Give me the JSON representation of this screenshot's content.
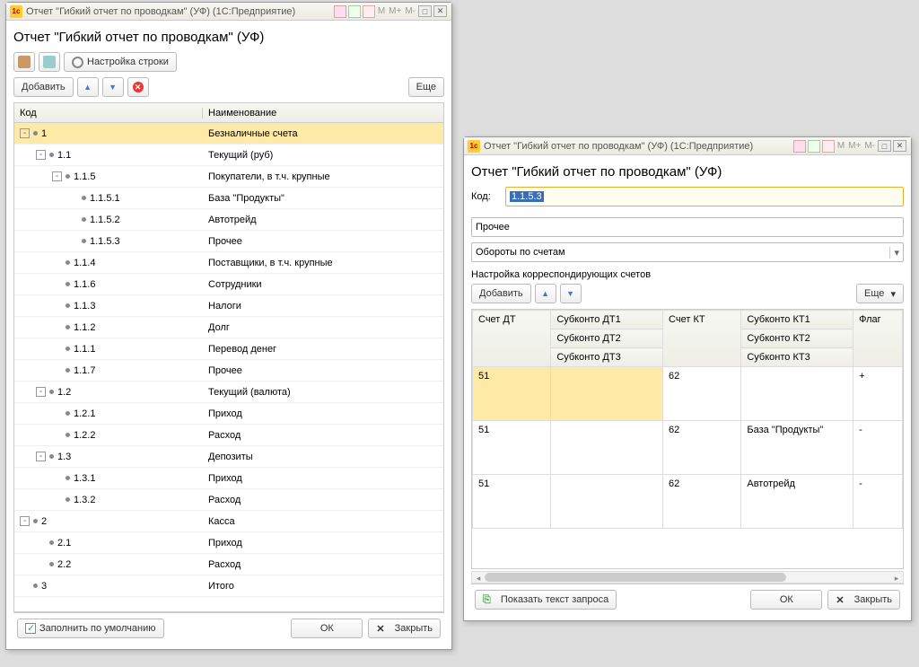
{
  "app_suffix": "(1С:Предприятие)",
  "memory_buttons": [
    "M",
    "M+",
    "M-"
  ],
  "w1": {
    "title_prefix": "Отчет \"Гибкий отчет по проводкам\" (УФ)  ",
    "heading": "Отчет \"Гибкий отчет по проводкам\" (УФ)",
    "settings_label": "Настройка строки",
    "add_label": "Добавить",
    "more_label": "Еще",
    "col_code": "Код",
    "col_name": "Наименование",
    "rows": [
      {
        "lvl": 0,
        "exp": "-",
        "code": "1",
        "name": "Безналичные счета",
        "sel": true
      },
      {
        "lvl": 1,
        "exp": "-",
        "code": "1.1",
        "name": "Текущий (руб)"
      },
      {
        "lvl": 2,
        "exp": "-",
        "code": "1.1.5",
        "name": "Покупатели, в т.ч. крупные"
      },
      {
        "lvl": 3,
        "exp": "",
        "code": "1.1.5.1",
        "name": "База \"Продукты\""
      },
      {
        "lvl": 3,
        "exp": "",
        "code": "1.1.5.2",
        "name": "Автотрейд"
      },
      {
        "lvl": 3,
        "exp": "",
        "code": "1.1.5.3",
        "name": "Прочее"
      },
      {
        "lvl": 2,
        "exp": "",
        "code": "1.1.4",
        "name": "Поставщики, в т.ч. крупные"
      },
      {
        "lvl": 2,
        "exp": "",
        "code": "1.1.6",
        "name": "Сотрудники"
      },
      {
        "lvl": 2,
        "exp": "",
        "code": "1.1.3",
        "name": "Налоги"
      },
      {
        "lvl": 2,
        "exp": "",
        "code": "1.1.2",
        "name": "Долг"
      },
      {
        "lvl": 2,
        "exp": "",
        "code": "1.1.1",
        "name": "Перевод денег"
      },
      {
        "lvl": 2,
        "exp": "",
        "code": "1.1.7",
        "name": "Прочее"
      },
      {
        "lvl": 1,
        "exp": "-",
        "code": "1.2",
        "name": "Текущий (валюта)"
      },
      {
        "lvl": 2,
        "exp": "",
        "code": "1.2.1",
        "name": "Приход"
      },
      {
        "lvl": 2,
        "exp": "",
        "code": "1.2.2",
        "name": "Расход"
      },
      {
        "lvl": 1,
        "exp": "-",
        "code": "1.3",
        "name": "Депозиты"
      },
      {
        "lvl": 2,
        "exp": "",
        "code": "1.3.1",
        "name": "Приход"
      },
      {
        "lvl": 2,
        "exp": "",
        "code": "1.3.2",
        "name": "Расход"
      },
      {
        "lvl": 0,
        "exp": "-",
        "code": "2",
        "name": "Касса"
      },
      {
        "lvl": 1,
        "exp": "",
        "code": "2.1",
        "name": "Приход"
      },
      {
        "lvl": 1,
        "exp": "",
        "code": "2.2",
        "name": "Расход"
      },
      {
        "lvl": 0,
        "exp": "",
        "code": "3",
        "name": "Итого"
      }
    ],
    "fill_default": "Заполнить по умолчанию",
    "ok": "ОК",
    "close": "Закрыть"
  },
  "w2": {
    "title_prefix": "Отчет \"Гибкий отчет по проводкам\" (УФ)  ",
    "heading": "Отчет \"Гибкий отчет по проводкам\" (УФ)",
    "code_label": "Код:",
    "code_value": "1.1.5.3",
    "name_value": "Прочее",
    "combo_value": "Обороты по счетам",
    "section_label": "Настройка корреспондирующих счетов",
    "add_label": "Добавить",
    "more_label": "Еще",
    "hdr": {
      "dt": "Счет ДТ",
      "sdt1": "Субконто ДТ1",
      "sdt2": "Субконто ДТ2",
      "sdt3": "Субконто ДТ3",
      "kt": "Счет КТ",
      "skt1": "Субконто КТ1",
      "skt2": "Субконто КТ2",
      "skt3": "Субконто КТ3",
      "flag": "Флаг"
    },
    "rows": [
      {
        "dt": "51",
        "sdt": "",
        "kt": "62",
        "skt": "",
        "flag": "+",
        "sel": true
      },
      {
        "dt": "51",
        "sdt": "",
        "kt": "62",
        "skt": "База \"Продукты\"",
        "flag": "-"
      },
      {
        "dt": "51",
        "sdt": "",
        "kt": "62",
        "skt": "Автотрейд",
        "flag": "-"
      }
    ],
    "show_query": "Показать текст запроса",
    "ok": "ОК",
    "close": "Закрыть"
  }
}
